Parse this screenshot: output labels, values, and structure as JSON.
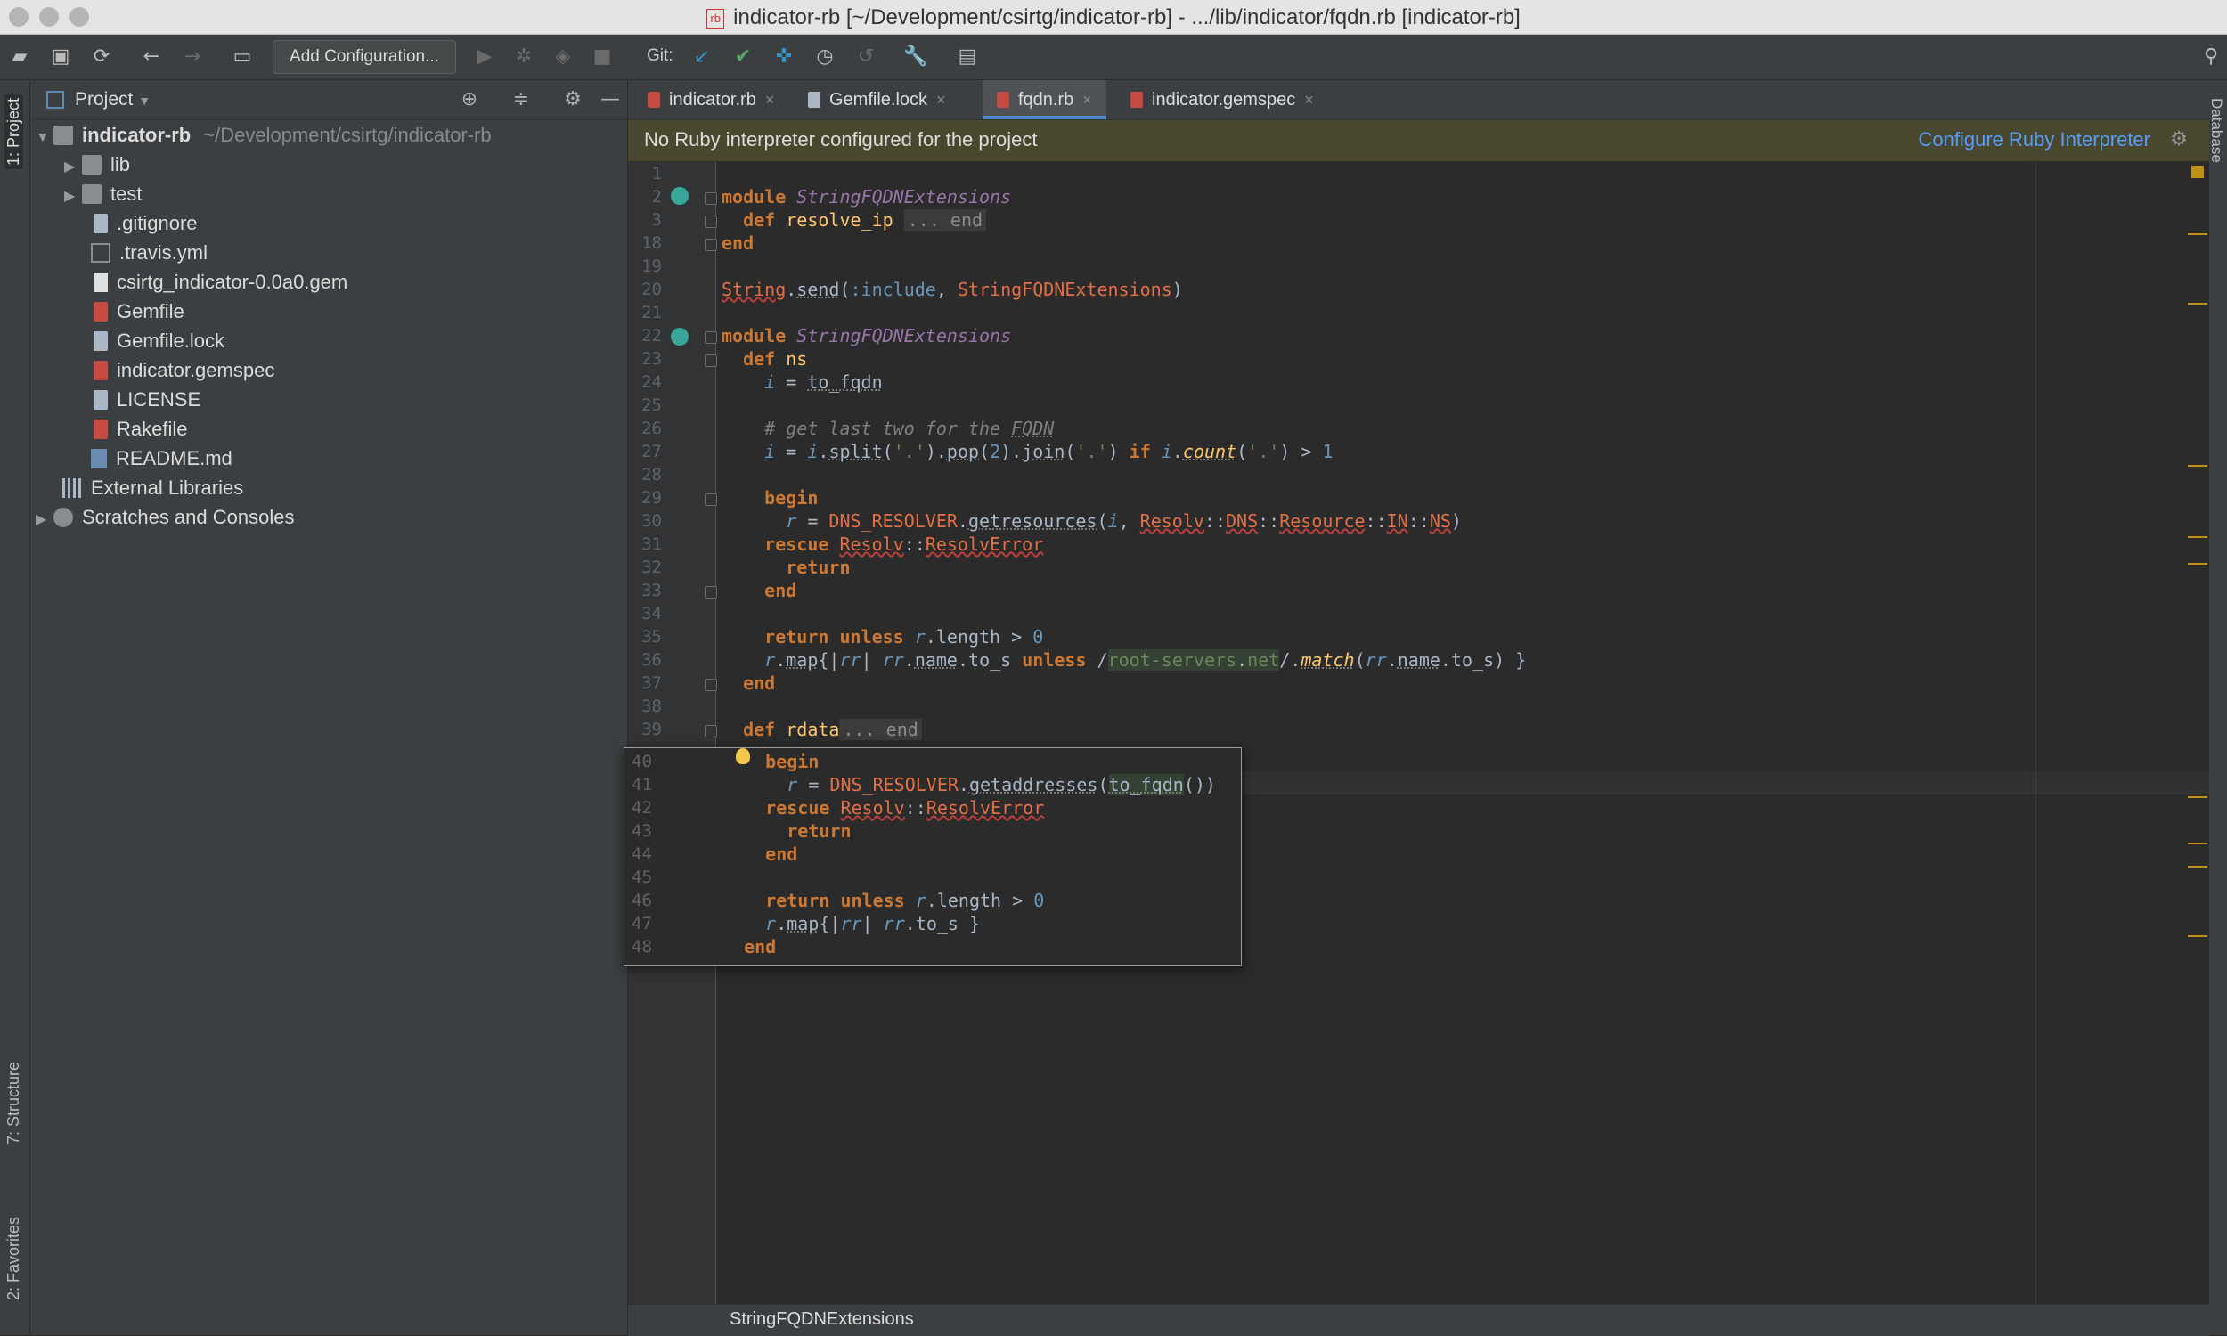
{
  "window": {
    "title": "indicator-rb [~/Development/csirtg/indicator-rb] - .../lib/indicator/fqdn.rb [indicator-rb]",
    "file_badge": "rb"
  },
  "toolbar": {
    "add_configuration": "Add Configuration...",
    "git_label": "Git:"
  },
  "side_tabs": {
    "project": "1: Project",
    "structure": "7: Structure",
    "favorites": "2: Favorites",
    "database": "Database"
  },
  "project_panel": {
    "title": "Project",
    "root_name": "indicator-rb",
    "root_path": "~/Development/csirtg/indicator-rb",
    "items": [
      {
        "label": "lib",
        "icon": "folder-icon"
      },
      {
        "label": "test",
        "icon": "folder-icon"
      },
      {
        "label": ".gitignore",
        "icon": "text-file-icon"
      },
      {
        "label": ".travis.yml",
        "icon": "yaml-file-icon"
      },
      {
        "label": "csirtg_indicator-0.0a0.gem",
        "icon": "file-icon"
      },
      {
        "label": "Gemfile",
        "icon": "ruby-file-icon"
      },
      {
        "label": "Gemfile.lock",
        "icon": "text-file-icon"
      },
      {
        "label": "indicator.gemspec",
        "icon": "ruby-file-icon"
      },
      {
        "label": "LICENSE",
        "icon": "text-file-icon"
      },
      {
        "label": "Rakefile",
        "icon": "ruby-file-icon"
      },
      {
        "label": "README.md",
        "icon": "markdown-file-icon"
      },
      {
        "label": "External Libraries",
        "icon": "library-icon"
      },
      {
        "label": "Scratches and Consoles",
        "icon": "scratches-icon"
      }
    ]
  },
  "tabs": [
    {
      "label": "indicator.rb",
      "close": "×"
    },
    {
      "label": "Gemfile.lock",
      "close": "×"
    },
    {
      "label": "fqdn.rb",
      "close": "×"
    },
    {
      "label": "indicator.gemspec",
      "close": "×"
    }
  ],
  "notification": {
    "message": "No Ruby interpreter configured for the project",
    "action": "Configure Ruby Interpreter"
  },
  "code": {
    "line_numbers": [
      "1",
      "2",
      "3",
      "18",
      "19",
      "20",
      "21",
      "22",
      "23",
      "24",
      "25",
      "26",
      "27",
      "28",
      "29",
      "30",
      "31",
      "32",
      "33",
      "34",
      "35",
      "36",
      "37",
      "38",
      "39"
    ],
    "folded_placeholder": "... end"
  },
  "popup": {
    "line_numbers": [
      "40",
      "41",
      "42",
      "43",
      "44",
      "45",
      "46",
      "47",
      "48"
    ]
  },
  "statusbar": {
    "breadcrumb": "StringFQDNExtensions"
  },
  "colors": {
    "accent": "#4a88c7",
    "link": "#589df6",
    "keyword": "#cc7832",
    "warning_stripe": "#be9117"
  }
}
